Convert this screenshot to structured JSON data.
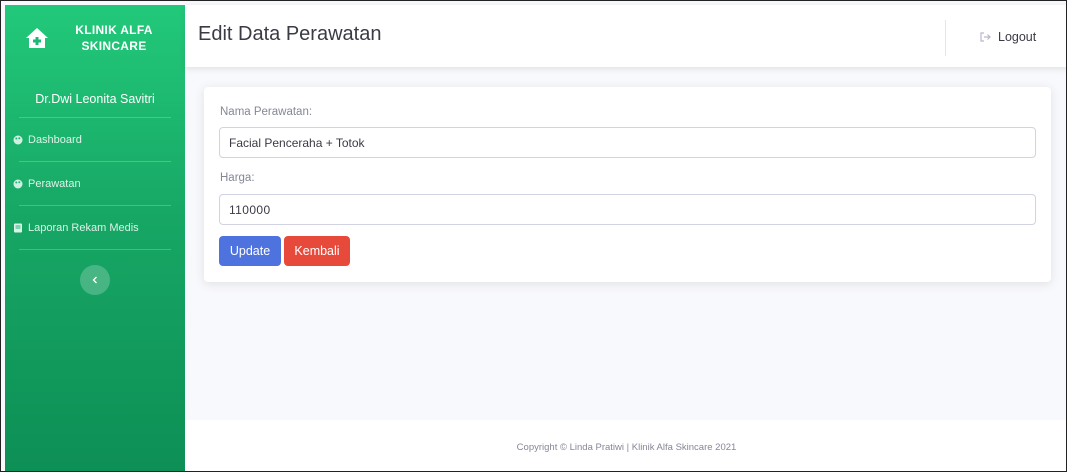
{
  "app": {
    "brand": {
      "line1": "KLINIK ALFA",
      "line2": "SKINCARE",
      "icon": "clinic-home-icon"
    },
    "user_name": "Dr.Dwi Leonita Savitri"
  },
  "sidebar": {
    "items": [
      {
        "label": "Dashboard",
        "icon": "palette-icon"
      },
      {
        "label": "Perawatan",
        "icon": "palette-icon"
      },
      {
        "label": "Laporan Rekam Medis",
        "icon": "book-icon"
      }
    ],
    "toggle_icon": "chevron-left-icon"
  },
  "header": {
    "title": "Edit Data Perawatan",
    "logout_label": "Logout",
    "logout_icon": "sign-out-icon"
  },
  "form": {
    "name_label": "Nama Perawatan:",
    "name_value": "Facial Penceraha + Totok",
    "price_label": "Harga:",
    "price_value": "110000",
    "update_label": "Update",
    "back_label": "Kembali"
  },
  "footer": {
    "text": "Copyright © Linda Pratiwi | Klinik Alfa Skincare 2021"
  },
  "colors": {
    "sidebar_green": "#1cc88a",
    "primary": "#4e73df",
    "danger": "#e74a3b",
    "background": "#f8f9fc"
  }
}
